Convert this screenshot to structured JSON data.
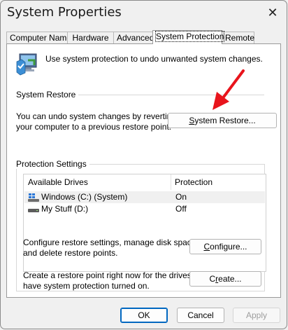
{
  "window": {
    "title": "System Properties",
    "close_icon": "close-icon"
  },
  "tabs": [
    {
      "label": "Computer Name",
      "active": false
    },
    {
      "label": "Hardware",
      "active": false
    },
    {
      "label": "Advanced",
      "active": false
    },
    {
      "label": "System Protection",
      "active": true
    },
    {
      "label": "Remote",
      "active": false
    }
  ],
  "intro": {
    "icon": "system-protection-icon",
    "text": "Use system protection to undo unwanted system changes."
  },
  "system_restore": {
    "group_label": "System Restore",
    "description_line1": "You can undo system changes by reverting",
    "description_line2": "your computer to a previous restore point.",
    "button_label_pre": "",
    "button_label_u": "S",
    "button_label_post": "ystem Restore..."
  },
  "protection_settings": {
    "group_label": "Protection Settings",
    "columns": [
      "Available Drives",
      "Protection"
    ],
    "drives": [
      {
        "name": "Windows (C:) (System)",
        "protection": "On",
        "icon": "windows-drive-icon",
        "selected": true
      },
      {
        "name": "My Stuff (D:)",
        "protection": "Off",
        "icon": "drive-icon",
        "selected": false
      }
    ],
    "configure_text_line1": "Configure restore settings, manage disk space,",
    "configure_text_line2": "and delete restore points.",
    "configure_button_pre": "",
    "configure_button_u": "C",
    "configure_button_post": "onfigure...",
    "create_text_line1": "Create a restore point right now for the drives that",
    "create_text_line2": "have system protection turned on.",
    "create_button_pre": "C",
    "create_button_u": "r",
    "create_button_post": "eate..."
  },
  "footer": {
    "ok_label": "OK",
    "cancel_label": "Cancel",
    "apply_label": "Apply"
  },
  "colors": {
    "accent": "#0067c0",
    "arrow": "#e8141c"
  }
}
